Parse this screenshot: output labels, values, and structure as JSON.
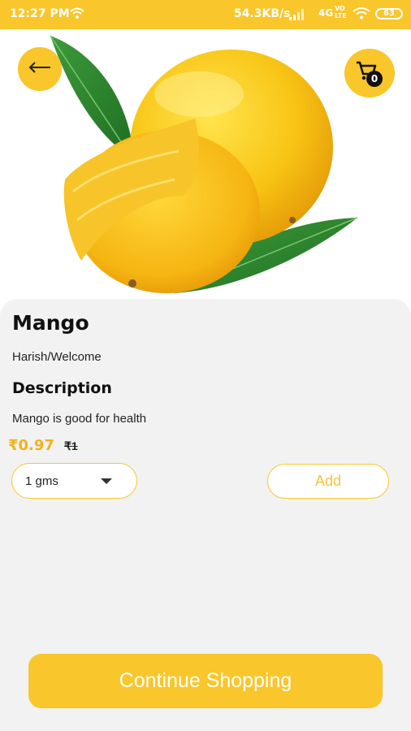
{
  "statusbar": {
    "time": "12:27 PM",
    "speed": "54.3KB/s",
    "network": "4G",
    "vo_top": "VO",
    "vo_bottom": "LTE",
    "battery": "63"
  },
  "header": {
    "back_icon": "arrow-left-icon",
    "cart_icon": "shopping-cart-icon",
    "cart_count": "0"
  },
  "product": {
    "image": "mango-fruit-image",
    "name": "Mango",
    "breadcrumb": "Harish/Welcome",
    "description_heading": "Description",
    "description": "Mango is good for health",
    "price": "₹0.97",
    "mrp": "₹1",
    "quantity_selected": "1 gms",
    "add_label": "Add"
  },
  "footer": {
    "continue_label": "Continue Shopping"
  },
  "colors": {
    "accent": "#f9c62b",
    "price": "#f3b21a",
    "card_bg": "#f2f2f2"
  }
}
